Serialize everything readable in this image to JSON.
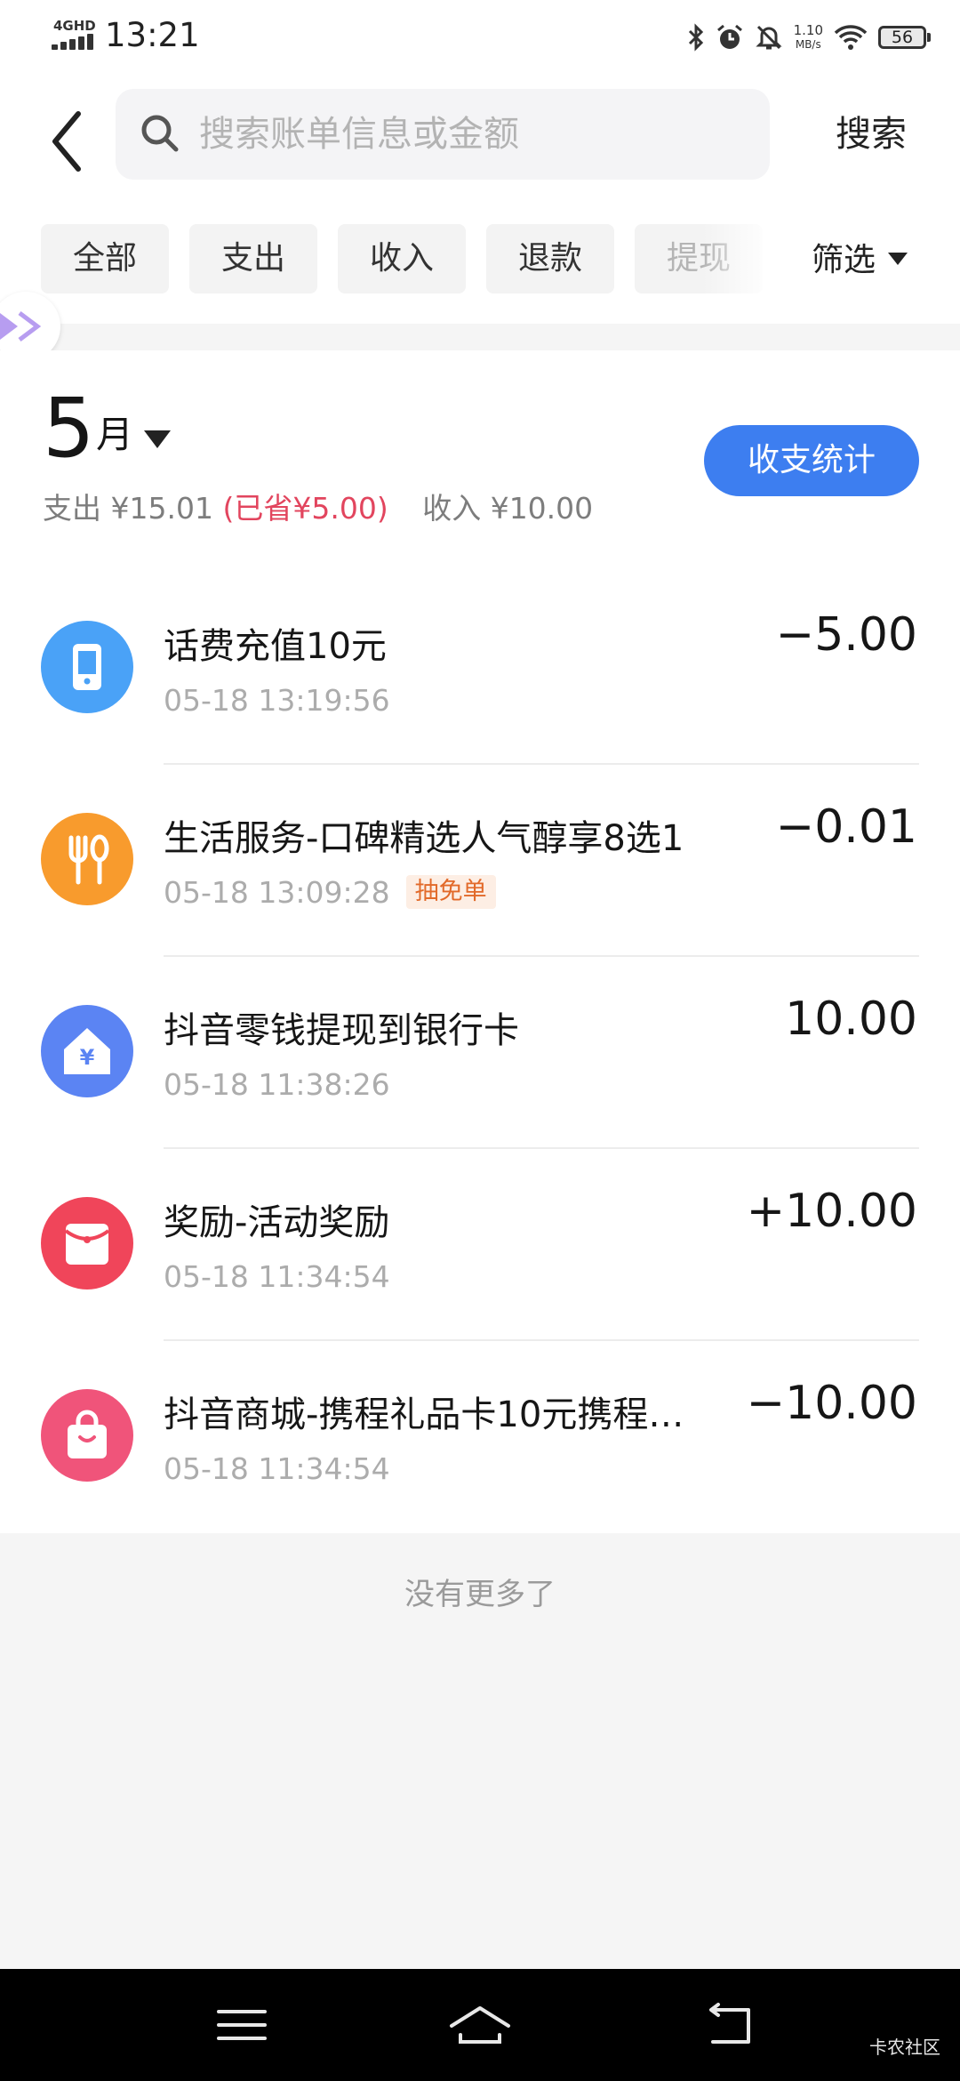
{
  "status_bar": {
    "network": "4GHD",
    "time": "13:21",
    "speed_value": "1.10",
    "speed_unit": "MB/s",
    "battery": "56"
  },
  "header": {
    "search_placeholder": "搜索账单信息或金额",
    "search_button": "搜索"
  },
  "filters": {
    "tabs": [
      "全部",
      "支出",
      "收入",
      "退款",
      "提现"
    ],
    "filter_label": "筛选"
  },
  "summary": {
    "month_number": "5",
    "month_unit": "月",
    "stats_button": "收支统计",
    "expense_text": "支出 ¥15.01",
    "saved_text": "(已省¥5.00)",
    "income_text": "收入 ¥10.00"
  },
  "transactions": [
    {
      "title": "话费充值10元",
      "time": "05-18 13:19:56",
      "amount": "−5.00",
      "tag": "",
      "icon": "phone-icon",
      "color": "#4aa2f7"
    },
    {
      "title": "生活服务-口碑精选人气醇享8选1",
      "time": "05-18 13:09:28",
      "amount": "−0.01",
      "tag": "抽免单",
      "icon": "fork-spoon-icon",
      "color": "#f89b2d"
    },
    {
      "title": "抖音零钱提现到银行卡",
      "time": "05-18 11:38:26",
      "amount": "10.00",
      "tag": "",
      "icon": "bank-house-icon",
      "color": "#5b84f3"
    },
    {
      "title": "奖励-活动奖励",
      "time": "05-18 11:34:54",
      "amount": "+10.00",
      "tag": "",
      "icon": "red-envelope-icon",
      "color": "#f0455a"
    },
    {
      "title": "抖音商城-携程礼品卡10元携程…",
      "time": "05-18 11:34:54",
      "amount": "−10.00",
      "tag": "",
      "icon": "shopping-bag-icon",
      "color": "#f0547a"
    }
  ],
  "footer": {
    "no_more": "没有更多了"
  },
  "watermark": "卡农社区"
}
